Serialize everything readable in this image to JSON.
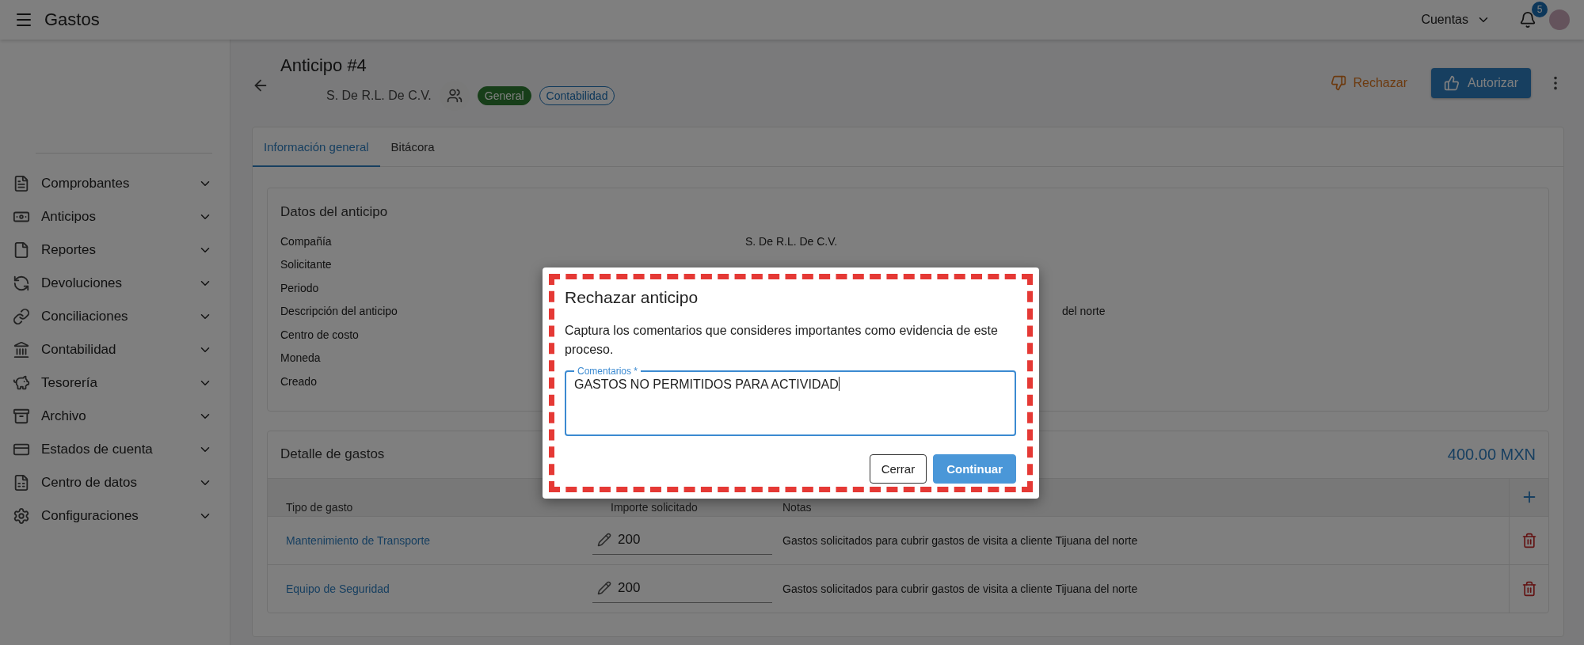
{
  "topbar": {
    "title": "Gastos",
    "account_menu": "Cuentas",
    "notifications": "5"
  },
  "sidebar": {
    "items": [
      {
        "label": "Comprobantes"
      },
      {
        "label": "Anticipos"
      },
      {
        "label": "Reportes"
      },
      {
        "label": "Devoluciones"
      },
      {
        "label": "Conciliaciones"
      },
      {
        "label": "Contabilidad"
      },
      {
        "label": "Tesorería"
      },
      {
        "label": "Archivo"
      },
      {
        "label": "Estados de cuenta"
      },
      {
        "label": "Centro de datos"
      },
      {
        "label": "Configuraciones"
      }
    ]
  },
  "header": {
    "title": "Anticipo #4",
    "company": "S. De R.L. De C.V.",
    "chips": [
      {
        "label": "General",
        "kind": "filled"
      },
      {
        "label": "Contabilidad",
        "kind": "outlined"
      }
    ],
    "reject": "Rechazar",
    "authorize": "Autorizar"
  },
  "tabs": [
    {
      "label": "Información general",
      "selected": true
    },
    {
      "label": "Bitácora",
      "selected": false
    }
  ],
  "details": {
    "title": "Datos del anticipo",
    "rows": [
      {
        "label": "Compañía",
        "value": "S. De R.L. De C.V."
      },
      {
        "label": "Solicitante"
      },
      {
        "label": "Periodo"
      },
      {
        "label": "Descripción del anticipo",
        "value": "del norte",
        "kind": "partial"
      },
      {
        "label": "Centro de costo"
      },
      {
        "label": "Moneda"
      },
      {
        "label": "Creado"
      }
    ]
  },
  "expenses": {
    "title": "Detalle de gastos",
    "total": "400.00 MXN",
    "columns": [
      "Tipo de gasto",
      "Importe solicitado",
      "Notas"
    ],
    "rows": [
      {
        "type": "Mantenimiento de Transporte",
        "amount": "200",
        "notes": "Gastos solicitados para cubrir gastos de visita a cliente Tijuana del norte"
      },
      {
        "type": "Equipo de Seguridad",
        "amount": "200",
        "notes": "Gastos solicitados para cubrir gastos de visita a cliente Tijuana del norte"
      }
    ]
  },
  "dialog": {
    "title": "Rechazar anticipo",
    "message": "Captura los comentarios que consideres importantes como evidencia de este proceso.",
    "field": {
      "label": "Comentarios *",
      "value": "GASTOS NO PERMITIDOS PARA ACTIVIDAD"
    },
    "buttons": [
      {
        "label": "Cerrar",
        "kind": "outlined"
      },
      {
        "label": "Continuar",
        "kind": "primary"
      }
    ]
  }
}
